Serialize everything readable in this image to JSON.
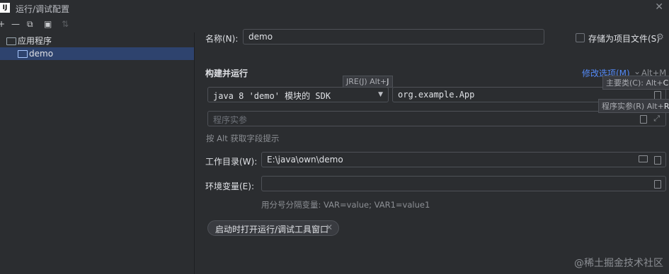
{
  "window": {
    "title": "运行/调试配置",
    "logo": "IJ"
  },
  "toolbar": {
    "icons": [
      "add-icon",
      "remove-icon",
      "copy-icon",
      "folder-icon",
      "sort-icon"
    ],
    "glyphs": {
      "add": "+",
      "remove": "—",
      "copy": "⧉",
      "folder": "▣",
      "sort": "⇅"
    }
  },
  "tree": {
    "group_label": "应用程序",
    "item_label": "demo"
  },
  "form": {
    "name_label": "名称(N):",
    "name_value": "demo",
    "store_label": "存储为项目文件(S)",
    "section_title": "构建并运行",
    "modify_options": "修改选项(M)",
    "modify_shortcut": "Alt+M",
    "jre_tooltip_prefix": "JRE(J) Alt+",
    "jre_tooltip_key": "J",
    "sdk_value": "java 8 'demo' 模块的 SDK",
    "main_class_tooltip_prefix": "主要类(C): Alt+",
    "main_class_tooltip_key": "C",
    "main_class_value": "org.example.App",
    "program_args_tooltip_prefix": "程序实参(R) Alt+",
    "program_args_tooltip_key": "R",
    "program_args_placeholder": "程序实参",
    "alt_hint": "按 Alt 获取字段提示",
    "workdir_label": "工作目录(W):",
    "workdir_value": "E:\\java\\own\\demo",
    "env_label": "环境变量(E):",
    "env_value": "",
    "env_hint": "用分号分隔变量: VAR=value; VAR1=value1",
    "chip_label": "启动时打开运行/调试工具窗口"
  },
  "watermark": "@稀土掘金技术社区",
  "colors": {
    "selection": "#2e436e",
    "link": "#548af7",
    "background": "#2b2d30"
  }
}
